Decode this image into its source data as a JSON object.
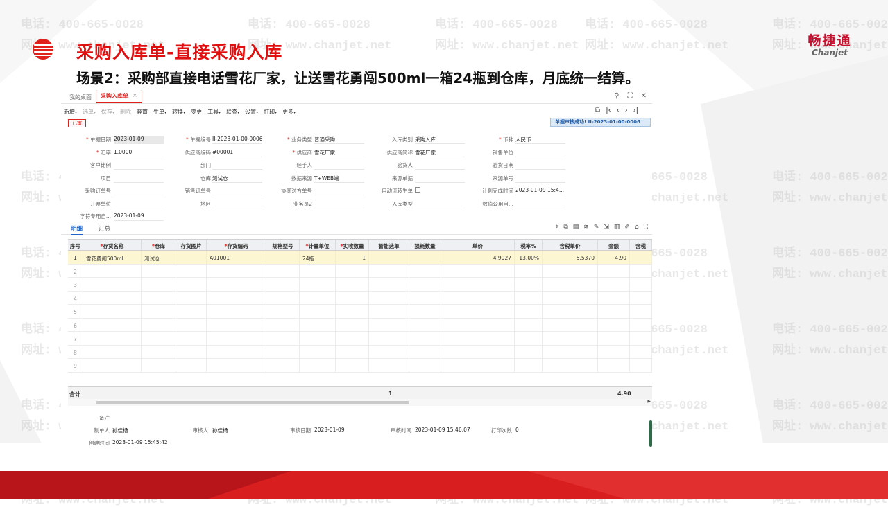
{
  "slide": {
    "title": "采购入库单-直接采购入库",
    "subtitle": "场景2：采购部直接电话雪花厂家，让送雪花勇闯500ml一箱24瓶到仓库，月底统一结算。",
    "brand_cn": "畅捷通",
    "brand_en": "Chanjet",
    "watermark_phone": "电话: 400-665-0028",
    "watermark_site": "网址: www.chanjet.net",
    "colors": {
      "accent": "#e0201b",
      "brand": "#c8102e",
      "selected_row": "#fdf6d3",
      "notice_bg": "#dce9f7"
    }
  },
  "app": {
    "tabs": [
      {
        "label": "我的桌面"
      },
      {
        "label": "采购入库单",
        "close": "×"
      }
    ],
    "window_icons": [
      "search-icon",
      "restore-icon",
      "close-icon"
    ],
    "window_glyphs": [
      "⚲",
      "⛶",
      "✕"
    ],
    "toolbar": [
      {
        "label": "新增",
        "dropdown": true
      },
      {
        "label": "选单",
        "dropdown": true,
        "disabled": true
      },
      {
        "label": "保存",
        "dropdown": true,
        "disabled": true
      },
      {
        "label": "删除",
        "disabled": true
      },
      {
        "label": "弃审"
      },
      {
        "label": "生单",
        "dropdown": true
      },
      {
        "label": "转换",
        "dropdown": true
      },
      {
        "label": "变更"
      },
      {
        "label": "工具",
        "dropdown": true
      },
      {
        "label": "联查",
        "dropdown": true
      },
      {
        "label": "设置",
        "dropdown": true
      },
      {
        "label": "打印",
        "dropdown": true
      },
      {
        "label": "更多",
        "dropdown": true
      }
    ],
    "nav_glyphs": [
      "⧉",
      "|‹",
      "‹",
      "›",
      "›|"
    ],
    "status_badge": "已审",
    "notice": "单据审核成功! II-2023-01-00-0006",
    "fields": {
      "doc_date_label": "单据日期",
      "doc_date": "2023-01-09",
      "doc_no_label": "单据编号",
      "doc_no": "II-2023-01-00-0006",
      "biz_type_label": "业务类型",
      "biz_type": "普通采购",
      "in_type_label": "入库类别",
      "in_type": "采购入库",
      "currency_label": "币种",
      "currency": "人民币",
      "rate_label": "汇率",
      "rate": "1.0000",
      "vendor_code_label": "供应商编码",
      "vendor_code": "#00001",
      "vendor_label": "供应商",
      "vendor": "雪花厂家",
      "vendor_abbr_label": "供应商简称",
      "vendor_abbr": "雪花厂家",
      "sales_unit_label": "销售单位",
      "sales_unit": "",
      "cust_ratio_label": "客户比例",
      "dept_label": "部门",
      "handler_label": "经手人",
      "inspector_label": "验货人",
      "inspect_date_label": "验货日期",
      "project_label": "项目",
      "warehouse_label": "仓库",
      "warehouse": "测试仓",
      "data_source_label": "数据来源",
      "data_source": "T+WEB端",
      "source_doc_label": "来源单据",
      "source_no_label": "来源单号",
      "po_no_label": "采购订单号",
      "so_no_label": "销售订单号",
      "partner_no_label": "协同对方单号",
      "auto_transfer_label": "自动流转生单",
      "plan_time_label": "计划完成时间",
      "plan_time": "2023-01-09 15:4...",
      "invoice_unit_label": "开票单位",
      "region_label": "地区",
      "clerk2_label": "业务员2",
      "in_type2_label": "入库类型",
      "custom_label": "数值公用自...",
      "char_custom_label": "字符专用自...",
      "char_custom": "2023-01-09"
    },
    "subtabs": [
      "明细",
      "汇总"
    ],
    "grid_icons": [
      "location-icon",
      "copy-icon",
      "list-icon",
      "filter-icon",
      "edit-icon",
      "export-icon",
      "columns-icon",
      "ruler-icon",
      "home-icon",
      "fullscreen-icon"
    ],
    "grid_glyphs": [
      "⌖",
      "⧉",
      "▤",
      "≋",
      "✎",
      "⇲",
      "▥",
      "✐",
      "⌂",
      "⛶"
    ],
    "columns": [
      "序号",
      "存货名称",
      "仓库",
      "存货图片",
      "存货编码",
      "规格型号",
      "计量单位",
      "实收数量",
      "智能选单",
      "损耗数量",
      "单价",
      "税率%",
      "含税单价",
      "金额",
      "含税"
    ],
    "rows": [
      {
        "seq": "1",
        "name": "雪花勇闯500ml",
        "warehouse": "测试仓",
        "image": "",
        "code": "A01001",
        "spec": "",
        "unit": "24瓶",
        "qty": "1",
        "smart": "",
        "loss": "",
        "price": "4.9027",
        "tax_rate": "13.00%",
        "tax_price": "5.5370",
        "amount": "4.90",
        "tax_amount": ""
      }
    ],
    "empty_seq": [
      "2",
      "3",
      "4",
      "5",
      "6",
      "7",
      "8",
      "9"
    ],
    "total_label": "合计",
    "total_qty": "1",
    "total_amount": "4.90",
    "footer": {
      "remark_label": "备注",
      "maker_label": "制单人",
      "maker": "孙佳杨",
      "auditor_label": "审核人",
      "auditor": "孙佳杨",
      "audit_date_label": "审核日期",
      "audit_date": "2023-01-09",
      "audit_time_label": "审核时间",
      "audit_time": "2023-01-09 15:46:07",
      "print_count_label": "打印次数",
      "print_count": "0",
      "create_time_label": "创建时间",
      "create_time": "2023-01-09 15:45:42"
    }
  }
}
